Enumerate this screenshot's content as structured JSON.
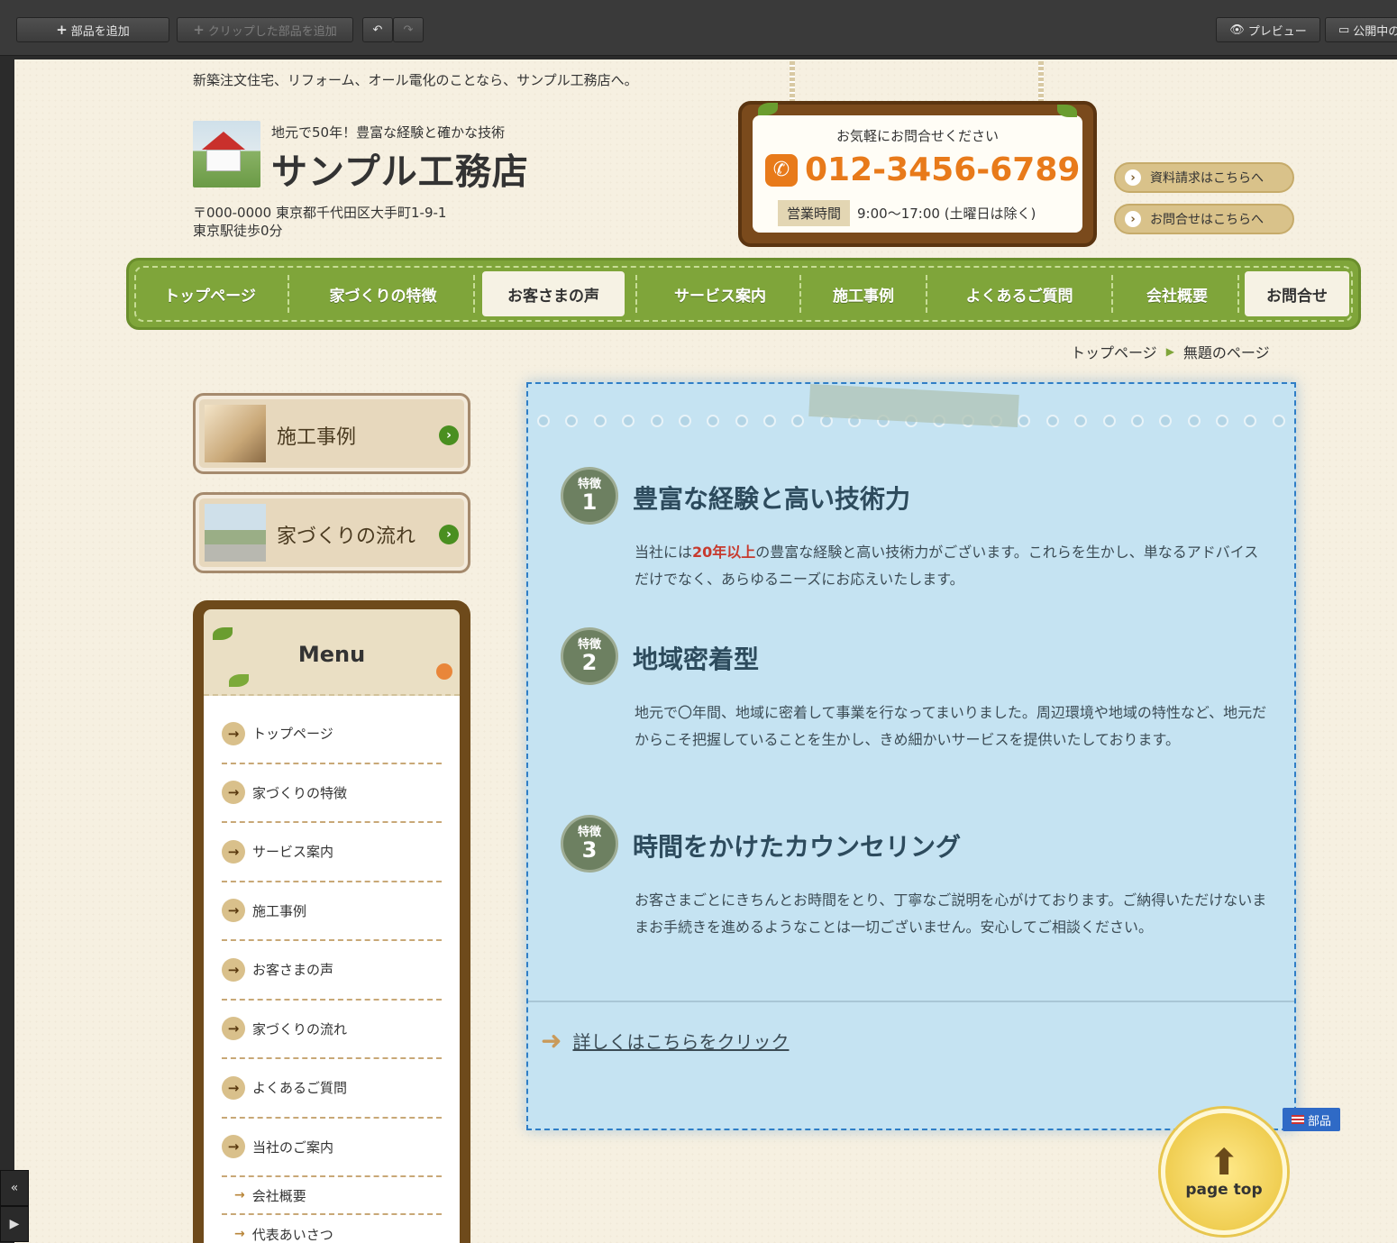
{
  "toolbar": {
    "add_part": "部品を追加",
    "add_clipped": "クリップした部品を追加",
    "undo_icon": "undo-icon",
    "redo_icon": "redo-icon",
    "preview": "プレビュー",
    "published": "公開中の"
  },
  "header": {
    "tagline": "新築注文住宅、リフォーム、オール電化のことなら、サンプル工務店へ。",
    "logo_sub": "地元で50年！豊富な経験と確かな技術",
    "logo_title": "サンプル工務店",
    "address_line1": "〒000-0000 東京都千代田区大手町1-9-1",
    "address_line2": "東京駅徒歩0分"
  },
  "contact": {
    "prompt": "お気軽にお問合せください",
    "phone": "012-3456-6789",
    "hours_label": "営業時間",
    "hours": "9:00〜17:00 (土曜日は除く)",
    "btn_request": "資料請求はこちらへ",
    "btn_inquiry": "お問合せはこちらへ"
  },
  "nav": {
    "items": [
      "トップページ",
      "家づくりの特徴",
      "お客さまの声",
      "サービス案内",
      "施工事例",
      "よくあるご質問",
      "会社概要",
      "お問合せ"
    ]
  },
  "breadcrumb": {
    "home": "トップページ",
    "current": "無題のページ"
  },
  "sidebar": {
    "banner1": "施工事例",
    "banner2": "家づくりの流れ",
    "menu_title": "Menu",
    "menu_items": [
      "トップページ",
      "家づくりの特徴",
      "サービス案内",
      "施工事例",
      "お客さまの声",
      "家づくりの流れ",
      "よくあるご質問",
      "当社のご案内"
    ],
    "menu_sub_items": [
      "会社概要",
      "代表あいさつ"
    ]
  },
  "features": [
    {
      "badge_label": "特徴",
      "num": "1",
      "title": "豊富な経験と高い技術力",
      "body_pre": "当社には",
      "body_hl": "20年以上",
      "body_post": "の豊富な経験と高い技術力がございます。これらを生かし、単なるアドバイスだけでなく、あらゆるニーズにお応えいたします。"
    },
    {
      "badge_label": "特徴",
      "num": "2",
      "title": "地域密着型",
      "body": "地元で〇年間、地域に密着して事業を行なってまいりました。周辺環境や地域の特性など、地元だからこそ把握していることを生かし、きめ細かいサービスを提供いたしております。"
    },
    {
      "badge_label": "特徴",
      "num": "3",
      "title": "時間をかけたカウンセリング",
      "body": "お客さまごとにきちんとお時間をとり、丁寧なご説明を心がけております。ご納得いただけないままお手続きを進めるようなことは一切ございません。安心してご相談ください。"
    }
  ],
  "more_link": "詳しくはこちらをクリック",
  "part_badge": "部品",
  "page_top": "page top",
  "colors": {
    "accent_green": "#7fa53a",
    "phone_orange": "#e87a1a",
    "content_blue": "#c5e3f2",
    "highlight_red": "#c73a2e"
  }
}
